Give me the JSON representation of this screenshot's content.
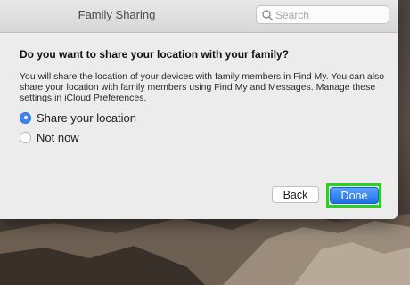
{
  "window": {
    "title": "Family Sharing"
  },
  "search": {
    "placeholder": "Search",
    "icon": "search-icon"
  },
  "dialog": {
    "heading": "Do you want to share your location with your family?",
    "description": "You will share the location of your devices with family members in Find My. You can also share your location with family members using Find My and Messages. Manage these settings in iCloud Preferences.",
    "options": [
      {
        "label": "Share your location",
        "selected": true
      },
      {
        "label": "Not now",
        "selected": false
      }
    ],
    "buttons": {
      "back": "Back",
      "done": "Done"
    }
  },
  "colors": {
    "accent": "#3e86f5",
    "highlight": "#2bd11f"
  }
}
